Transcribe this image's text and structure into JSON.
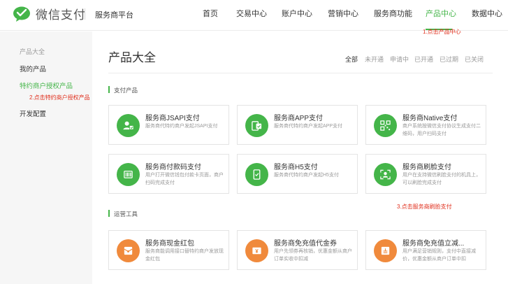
{
  "brand": {
    "name": "微信支付",
    "platform": "服务商平台"
  },
  "nav": [
    {
      "label": "首页",
      "active": false
    },
    {
      "label": "交易中心",
      "active": false
    },
    {
      "label": "账户中心",
      "active": false
    },
    {
      "label": "营销中心",
      "active": false
    },
    {
      "label": "服务商功能",
      "active": false
    },
    {
      "label": "产品中心",
      "active": true
    },
    {
      "label": "数据中心",
      "active": false
    }
  ],
  "sidebar": {
    "heading": "产品大全",
    "items": [
      {
        "label": "我的产品",
        "active": false
      },
      {
        "label": "特约商户授权产品",
        "active": true
      },
      {
        "label": "开发配置",
        "active": false
      }
    ]
  },
  "main": {
    "title": "产品大全",
    "filters": [
      "全部",
      "未开通",
      "申请中",
      "已开通",
      "已过期",
      "已关闭"
    ],
    "sections": [
      {
        "label": "支付产品",
        "cards": [
          {
            "title": "服务商JSAPI支付",
            "desc": "服务商代特约商户发起JSAPI支付",
            "icon": "user-pay-icon",
            "color": "#44b549"
          },
          {
            "title": "服务商APP支付",
            "desc": "服务商代特约商户发起APP支付",
            "icon": "app-phone-icon",
            "color": "#44b549"
          },
          {
            "title": "服务商Native支付",
            "desc": "商户系统按微信支付协议生成支付二维码，用户扫码支付",
            "icon": "qrcode-icon",
            "color": "#44b549"
          },
          {
            "title": "服务商付款码支付",
            "desc": "用户打开微信钱包付款卡页面，商户扫码完成支付",
            "icon": "barcode-icon",
            "color": "#44b549"
          },
          {
            "title": "服务商H5支付",
            "desc": "服务商代特约商户发起H5支付",
            "icon": "h5-phone-icon",
            "color": "#44b549"
          },
          {
            "title": "服务商刷脸支付",
            "desc": "用户在支持微信刷脸支付的机具上，可以刷脸完成支付",
            "icon": "face-pay-icon",
            "color": "#44b549"
          }
        ]
      },
      {
        "label": "运营工具",
        "cards": [
          {
            "title": "服务商现金红包",
            "desc": "服务商能调用接口替特约商户发放现金红包",
            "icon": "red-packet-icon",
            "color": "#f08a3c"
          },
          {
            "title": "服务商免充值代金券",
            "desc": "用户先领券再核销，优惠金额从商户订单实收中扣减",
            "icon": "coupon-icon",
            "color": "#f08a3c"
          },
          {
            "title": "服务商免充值立减...",
            "desc": "用户满足营销规则，支付中直接减价，优惠金额从商户订单中扣",
            "icon": "discount-icon",
            "color": "#f08a3c"
          }
        ]
      }
    ]
  },
  "annotations": {
    "step1": "1.点击产品中心",
    "step2": "2.点击特约商户授权产品",
    "step3": "3.点击服务商刷脸支付"
  },
  "colors": {
    "accent": "#44b549",
    "tool": "#f08a3c",
    "annotation": "#e0301e"
  }
}
